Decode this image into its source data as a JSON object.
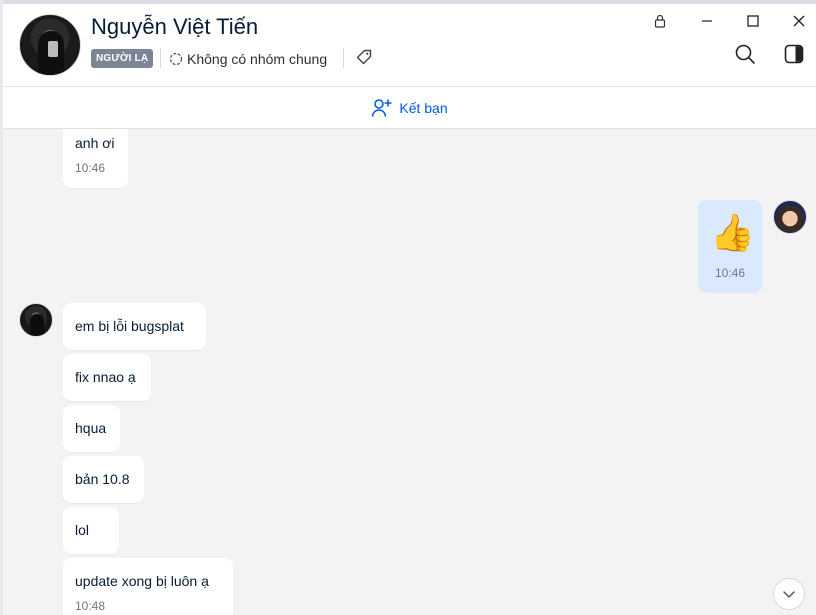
{
  "header": {
    "contact_name": "Nguyễn Việt Tiến",
    "badge": "NGƯỜI LẠ",
    "group_info": "Không có nhóm chung"
  },
  "friend_bar": {
    "label": "Kết bạn"
  },
  "messages": [
    {
      "text": "anh ơi",
      "time": "10:46"
    },
    {
      "text": "👍",
      "time": "10:46",
      "from_me": true
    },
    {
      "text": "em bị lỗi bugsplat"
    },
    {
      "text": "fix nnao ạ"
    },
    {
      "text": "hqua"
    },
    {
      "text": "bản 10.8"
    },
    {
      "text": "lol"
    },
    {
      "text": "update xong bị luôn ạ",
      "time": "10:48"
    }
  ],
  "icons": {
    "lock": "lock-icon",
    "minimize": "minimize-icon",
    "maximize": "maximize-icon",
    "close": "close-icon",
    "search": "search-icon",
    "sidebar": "sidebar-toggle-icon",
    "group": "group-icon",
    "tag": "tag-icon",
    "add_friend": "add-friend-icon",
    "scroll_down": "chevron-down-icon"
  },
  "colors": {
    "accent": "#005ae0",
    "my_bubble": "#dbe9ff",
    "chat_bg": "#f3f3f4",
    "badge_bg": "#7c8595"
  }
}
